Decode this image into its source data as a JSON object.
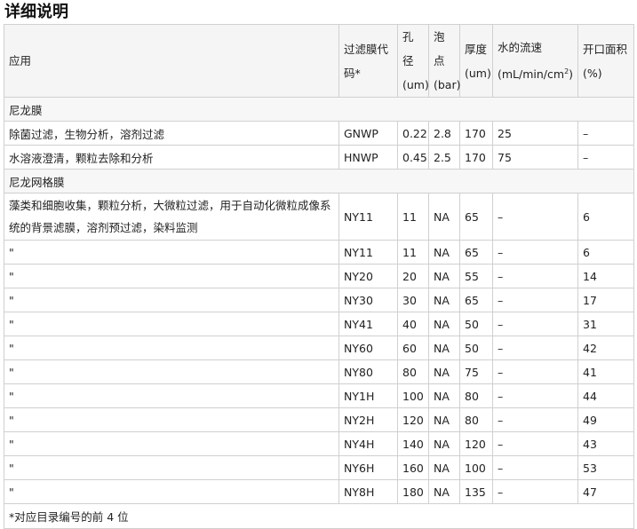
{
  "title": "详细说明",
  "headers": {
    "app": "应用",
    "code": "过滤膜代码*",
    "pore": "孔径(um)",
    "bubble": "泡点(bar)",
    "thick": "厚度(um)",
    "flow": "水的流速(mL/min/cm",
    "flow_sup": "2",
    "flow_end": ")",
    "open": "开口面积(%)"
  },
  "sections": [
    {
      "name": "尼龙膜",
      "rows": [
        {
          "app": "除菌过滤，生物分析，溶剂过滤",
          "code": "GNWP",
          "pore": "0.22",
          "bubble": "2.8",
          "thick": "170",
          "flow": "25",
          "open": "–"
        },
        {
          "app": "水溶液澄清，颗粒去除和分析",
          "code": "HNWP",
          "pore": "0.45",
          "bubble": "2.5",
          "thick": "170",
          "flow": "75",
          "open": "–"
        }
      ]
    },
    {
      "name": "尼龙网格膜",
      "rows": [
        {
          "app": "藻类和细胞收集，颗粒分析，大微粒过滤，用于自动化微粒成像系统的背景滤膜，溶剂预过滤，染料监测",
          "code": "NY11",
          "pore": "11",
          "bubble": "NA",
          "thick": "65",
          "flow": "–",
          "open": "6"
        },
        {
          "app": "\"",
          "code": "NY11",
          "pore": "11",
          "bubble": "NA",
          "thick": "65",
          "flow": "–",
          "open": "6"
        },
        {
          "app": "\"",
          "code": "NY20",
          "pore": "20",
          "bubble": "NA",
          "thick": "55",
          "flow": "–",
          "open": "14"
        },
        {
          "app": "\"",
          "code": "NY30",
          "pore": "30",
          "bubble": "NA",
          "thick": "65",
          "flow": "–",
          "open": "17"
        },
        {
          "app": "\"",
          "code": "NY41",
          "pore": "40",
          "bubble": "NA",
          "thick": "50",
          "flow": "–",
          "open": "31"
        },
        {
          "app": "\"",
          "code": "NY60",
          "pore": "60",
          "bubble": "NA",
          "thick": "50",
          "flow": "–",
          "open": "42"
        },
        {
          "app": "\"",
          "code": "NY80",
          "pore": "80",
          "bubble": "NA",
          "thick": "75",
          "flow": "–",
          "open": "41"
        },
        {
          "app": "\"",
          "code": "NY1H",
          "pore": "100",
          "bubble": "NA",
          "thick": "80",
          "flow": "–",
          "open": "44"
        },
        {
          "app": "\"",
          "code": "NY2H",
          "pore": "120",
          "bubble": "NA",
          "thick": "80",
          "flow": "–",
          "open": "49"
        },
        {
          "app": "\"",
          "code": "NY4H",
          "pore": "140",
          "bubble": "NA",
          "thick": "120",
          "flow": "–",
          "open": "43"
        },
        {
          "app": "\"",
          "code": "NY6H",
          "pore": "160",
          "bubble": "NA",
          "thick": "100",
          "flow": "–",
          "open": "53"
        },
        {
          "app": "\"",
          "code": "NY8H",
          "pore": "180",
          "bubble": "NA",
          "thick": "135",
          "flow": "–",
          "open": "47"
        }
      ]
    }
  ],
  "footnote": "*对应目录编号的前 4 位"
}
